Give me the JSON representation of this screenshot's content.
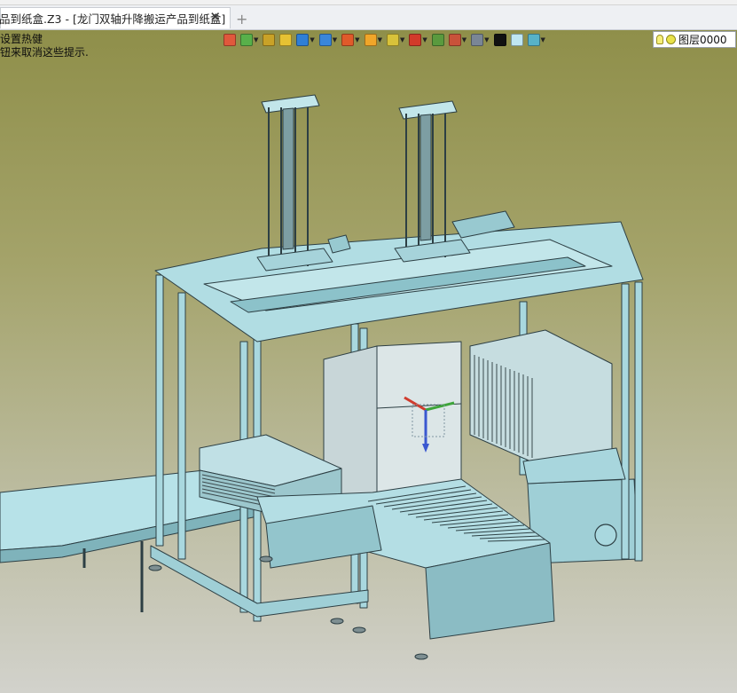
{
  "tab": {
    "title": "品到纸盒.Z3 - [龙门双轴升降搬运产品到纸盒]",
    "close_glyph": "✕",
    "new_tab_glyph": "+"
  },
  "hints": {
    "line1": "设置热健",
    "line2": "钮来取消这些提示."
  },
  "toolbar": {
    "icons": [
      {
        "name": "import-icon",
        "color": "#e0583c",
        "dropdown": false
      },
      {
        "name": "filter-icon",
        "color": "#58b04a",
        "dropdown": true
      },
      {
        "name": "pick-icon",
        "color": "#c9a227",
        "dropdown": false
      },
      {
        "name": "solid-icon",
        "color": "#e6c233",
        "dropdown": false
      },
      {
        "name": "cube-icon",
        "color": "#2f7fd6",
        "dropdown": true
      },
      {
        "name": "view-icon",
        "color": "#3a86d9",
        "dropdown": true
      },
      {
        "name": "light-icon",
        "color": "#e05a2a",
        "dropdown": true
      },
      {
        "name": "section-icon",
        "color": "#f0a629",
        "dropdown": true
      },
      {
        "name": "zoom-icon",
        "color": "#d8c23a",
        "dropdown": true
      },
      {
        "name": "axis-icon",
        "color": "#d23a2a",
        "dropdown": true
      },
      {
        "name": "frame-icon",
        "color": "#5a9a3e",
        "dropdown": false
      },
      {
        "name": "measure-icon",
        "color": "#c9523a",
        "dropdown": true
      },
      {
        "name": "display-icon",
        "color": "#7a8696",
        "dropdown": true
      },
      {
        "name": "line-style-icon",
        "color": "#111111",
        "dropdown": false
      },
      {
        "name": "color-swatch-icon",
        "color": "#bfe6f2",
        "dropdown": false
      },
      {
        "name": "layer-tools-icon",
        "color": "#57b2c8",
        "dropdown": true
      }
    ]
  },
  "layer": {
    "name": "图层0000"
  },
  "colors": {
    "part_fill": "#a9d8df",
    "part_edge": "#2d3f44",
    "axis_x": "#d03c2e",
    "axis_y": "#3ea53a",
    "axis_z": "#3a58d0"
  }
}
